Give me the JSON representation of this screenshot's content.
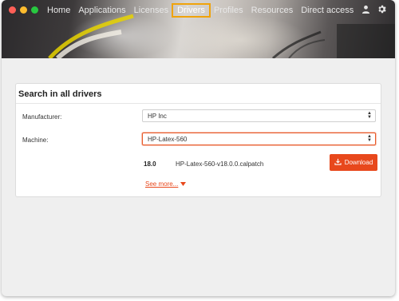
{
  "window": {
    "traffic_lights": [
      "close",
      "minimize",
      "zoom"
    ]
  },
  "nav": {
    "items": [
      {
        "label": "Home"
      },
      {
        "label": "Applications"
      },
      {
        "label": "Licenses"
      },
      {
        "label": "Drivers",
        "active": true
      },
      {
        "label": "Profiles"
      },
      {
        "label": "Resources"
      },
      {
        "label": "Direct access"
      }
    ],
    "active_highlight_color": "#f0a30a"
  },
  "top_icons": [
    "user-icon",
    "gear-icon"
  ],
  "search": {
    "title": "Search in all drivers",
    "manufacturer_label": "Manufacturer:",
    "manufacturer_value": "HP Inc",
    "machine_label": "Machine:",
    "machine_value": "HP-Latex-560"
  },
  "result": {
    "version": "18.0",
    "filename": "HP-Latex-560-v18.0.0.calpatch",
    "download_label": "Download"
  },
  "see_more_label": "See more...",
  "colors": {
    "accent": "#e8481c"
  }
}
